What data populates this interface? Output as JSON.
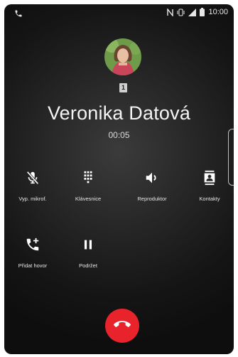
{
  "status_bar": {
    "time": "10:00",
    "icons": [
      "phone-call-icon",
      "nfc-icon",
      "vibrate-icon",
      "signal-icon",
      "battery-icon"
    ]
  },
  "call": {
    "caller_name": "Veronika Datová",
    "sim_slot": "1",
    "duration": "00:05"
  },
  "controls": {
    "mute": {
      "label": "Vyp. mikrof.",
      "icon": "mic-off-icon"
    },
    "keypad": {
      "label": "Klávesnice",
      "icon": "dialpad-icon"
    },
    "speaker": {
      "label": "Reproduktor",
      "icon": "speaker-icon"
    },
    "contacts": {
      "label": "Kontakty",
      "icon": "contacts-icon"
    },
    "add_call": {
      "label": "Přidat hovor",
      "icon": "add-call-icon"
    },
    "hold": {
      "label": "Podržet",
      "icon": "pause-icon"
    }
  },
  "end_call": {
    "icon": "end-call-icon"
  },
  "colors": {
    "background": "#1c1c1c",
    "end_call": "#e8232c",
    "text": "#ffffff"
  }
}
